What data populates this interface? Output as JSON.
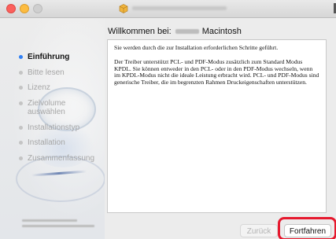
{
  "window": {
    "traffic_lights": {
      "close_color": "#fc605c",
      "minimize_color": "#fdbc40",
      "zoom_color": "#cfcfcf"
    },
    "title_icon": "package-icon"
  },
  "sidebar": {
    "steps": [
      {
        "label": "Einführung",
        "active": true
      },
      {
        "label": "Bitte lesen",
        "active": false
      },
      {
        "label": "Lizenz",
        "active": false
      },
      {
        "label": "Zielvolume auswählen",
        "active": false
      },
      {
        "label": "Installationstyp",
        "active": false
      },
      {
        "label": "Installation",
        "active": false
      },
      {
        "label": "Zusammenfassung",
        "active": false
      }
    ],
    "accent_color": "#2f7ff4"
  },
  "header": {
    "welcome_prefix": "Willkommen bei:",
    "welcome_suffix": "Macintosh"
  },
  "content": {
    "paragraph_1": "Sie werden durch die zur Installation erforderlichen Schritte geführt.",
    "paragraph_2": "Der Treiber unterstützt PCL- und PDF-Modus zusätzlich zum Standard Modus KPDL. Sie können entweder in den PCL- oder in den PDF-Modus wechseln, wenn im KPDL-Modus nicht die ideale Leistung erbracht wird. PCL- und PDF-Modus sind generische Treiber, die im begrenzten Rahmen Druckeigenschaften unterstützen."
  },
  "buttons": {
    "back_label": "Zurück",
    "continue_label": "Fortfahren"
  },
  "annotation": {
    "highlight_color": "#e6192e"
  }
}
